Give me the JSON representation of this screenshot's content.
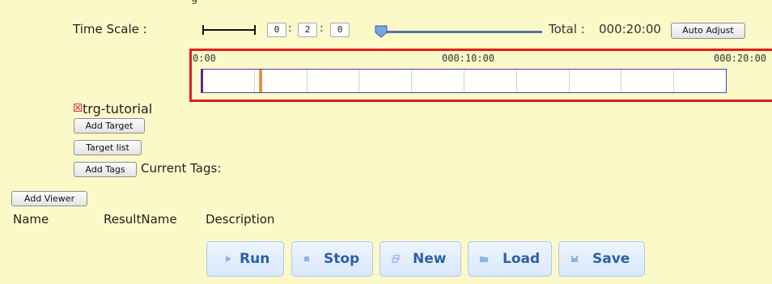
{
  "top_fragment": "g",
  "time_scale": {
    "label": "Time Scale :",
    "minutes_a": "0",
    "minutes_b": "2",
    "seconds": "0",
    "separator": ":",
    "slider_fraction": 0.0,
    "total_label": "Total :",
    "total_value": "000:20:00",
    "auto_adjust_label": "Auto Adjust"
  },
  "timeline": {
    "ticks": [
      "0:00",
      "000:10:00",
      "000:20:00"
    ],
    "grid_divisions": 10,
    "cursor_time_fraction": 0.11,
    "border_color": "#e21e1e",
    "track_border_color": "#4b3fb0"
  },
  "target": {
    "icon": "broken-image-icon",
    "name": "trg-tutorial"
  },
  "buttons": {
    "add_target": "Add Target",
    "target_list": "Target list",
    "add_tags": "Add Tags",
    "add_viewer": "Add Viewer"
  },
  "tags": {
    "label": "Current Tags:"
  },
  "viewer_columns": [
    "Name",
    "ResultName",
    "Description"
  ],
  "actions": [
    {
      "label": "Run",
      "icon": "play-icon"
    },
    {
      "label": "Stop",
      "icon": "stop-icon"
    },
    {
      "label": "New",
      "icon": "new-window-icon"
    },
    {
      "label": "Load",
      "icon": "folder-icon"
    },
    {
      "label": "Save",
      "icon": "disk-icon"
    }
  ],
  "colors": {
    "panel_bg": "#fcf9c9",
    "action_text": "#2d5fa6"
  }
}
